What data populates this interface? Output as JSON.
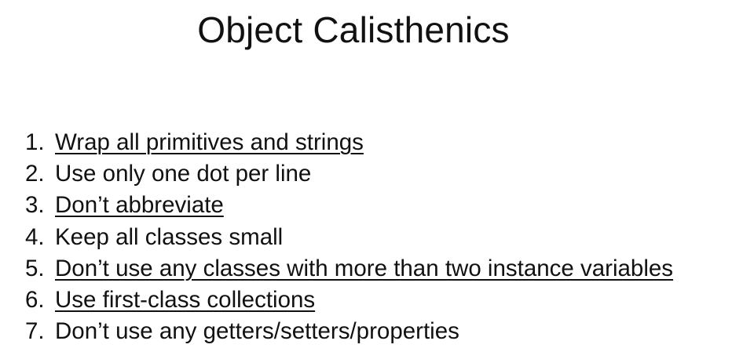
{
  "slide": {
    "title": "Object Calisthenics",
    "rules": [
      {
        "number": "1.",
        "text": "Wrap all primitives and strings",
        "linked": true
      },
      {
        "number": "2.",
        "text": "Use only one dot per line",
        "linked": false
      },
      {
        "number": "3.",
        "text": "Don’t abbreviate",
        "linked": true
      },
      {
        "number": "4.",
        "text": "Keep all classes small",
        "linked": false
      },
      {
        "number": "5.",
        "text": "Don’t use any classes with more than two instance variables",
        "linked": true
      },
      {
        "number": "6.",
        "text": "Use first-class collections",
        "linked": true
      },
      {
        "number": "7.",
        "text": "Don’t use any getters/setters/properties",
        "linked": false
      }
    ]
  }
}
